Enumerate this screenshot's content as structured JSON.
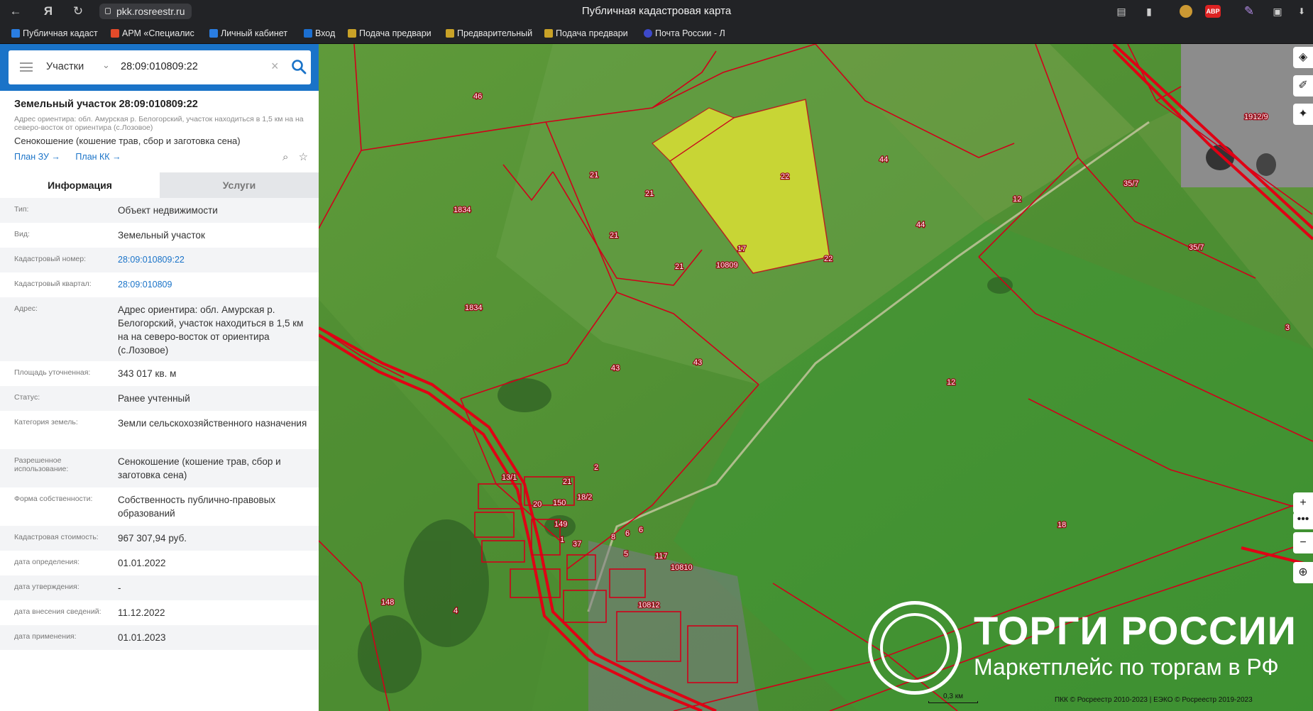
{
  "browser": {
    "url": "pkk.rosreestr.ru",
    "page_title": "Публичная кадастровая карта",
    "extensions": [
      "ABP"
    ]
  },
  "bookmarks": [
    "Публичная кадаст",
    "АРМ «Специалис",
    "Личный кабинет",
    "Вход",
    "Подача предвари",
    "Предварительный",
    "Подача предвари",
    "Почта России - Л"
  ],
  "search": {
    "type": "Участки",
    "query": "28:09:010809:22"
  },
  "object": {
    "title": "Земельный участок 28:09:010809:22",
    "address_short": "Адрес ориентира: обл. Амурская р. Белогорский, участок находиться в 1,5 км на на северо-восток от ориентира (с.Лозовое)",
    "use": "Сенокошение (кошение трав, сбор и заготовка сена)",
    "plan_zu": "План ЗУ →",
    "plan_kk": "План КК →"
  },
  "tabs": {
    "info": "Информация",
    "services": "Услуги"
  },
  "info_rows": [
    {
      "label": "Тип:",
      "value": "Объект недвижимости"
    },
    {
      "label": "Вид:",
      "value": "Земельный участок"
    },
    {
      "label": "Кадастровый номер:",
      "value": "28:09:010809:22"
    },
    {
      "label": "Кадастровый квартал:",
      "value": "28:09:010809"
    },
    {
      "label": "Адрес:",
      "value": "Адрес ориентира: обл. Амурская р. Белогорский, участок находиться в 1,5 км на на северо-восток от ориентира (с.Лозовое)"
    },
    {
      "label": "Площадь уточненная:",
      "value": "343 017 кв. м"
    },
    {
      "label": "Статус:",
      "value": "Ранее учтенный"
    },
    {
      "label": "Категория земель:",
      "value": "Земли сельскохозяйственного назначения"
    },
    {
      "label": "Разрешенное использование:",
      "value": "Сенокошение (кошение трав, сбор и заготовка сена)"
    },
    {
      "label": "Форма собственности:",
      "value": "Собственность публично-правовых образований"
    },
    {
      "label": "Кадастровая стоимость:",
      "value": "967 307,94 руб."
    },
    {
      "label": "дата определения:",
      "value": "01.01.2022"
    },
    {
      "label": "дата утверждения:",
      "value": "-"
    },
    {
      "label": "дата внесения сведений:",
      "value": "11.12.2022"
    },
    {
      "label": "дата применения:",
      "value": "01.01.2023"
    }
  ],
  "map": {
    "parcel_labels": [
      "46",
      "1834",
      "1834",
      "21",
      "21",
      "21",
      "21",
      "22",
      "22",
      "17",
      "10809",
      "44",
      "44",
      "12",
      "12",
      "35/7",
      "35/7",
      "1912/9",
      "3",
      "43",
      "43",
      "13/1",
      "2",
      "21",
      "150",
      "20",
      "18/2",
      "149",
      "1",
      "37",
      "8",
      "6",
      "6",
      "5",
      "117",
      "10810",
      "10812",
      "18",
      "4",
      "148"
    ],
    "scale": "0,3 км",
    "copyright": "ПКК © Росреестр 2010-2023 | ЕЭКО © Росреестр 2019-2023"
  },
  "watermark": {
    "line1": "ТОРГИ РОССИИ",
    "line2": "Маркетплейс по торгам в РФ"
  },
  "colors": {
    "panel_blue": "#1a73c8",
    "parcel_border": "#d0001a",
    "selected_fill": "#e6e633"
  }
}
